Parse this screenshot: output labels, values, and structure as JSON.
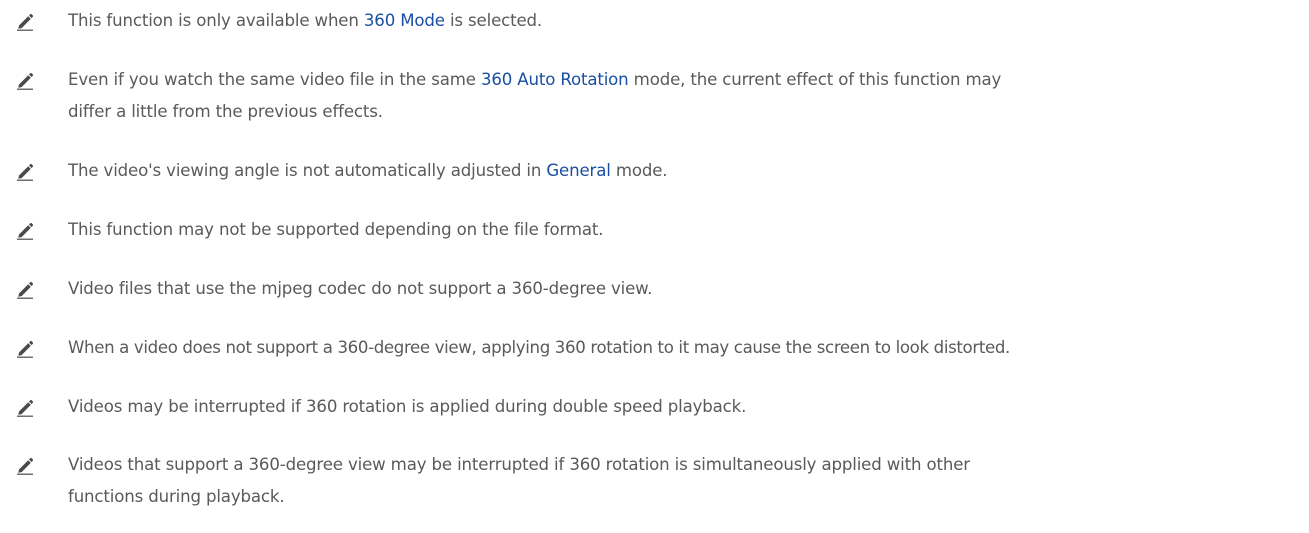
{
  "notes": [
    {
      "icon": "pencil-icon",
      "before": "This function is only available when ",
      "highlight": "360 Mode",
      "after": " is selected."
    },
    {
      "icon": "pencil-icon",
      "before": "Even if you watch the same video file in the same ",
      "highlight": "360 Auto Rotation",
      "after": " mode, the current effect of this function may",
      "line2": "differ a little from the previous effects."
    },
    {
      "icon": "pencil-icon",
      "before": "The video's viewing angle is not automatically adjusted in ",
      "highlight": "General",
      "after": " mode."
    },
    {
      "icon": "pencil-icon",
      "text": "This function may not be supported depending on the file format."
    },
    {
      "icon": "pencil-icon",
      "text": "Video files that use the mjpeg codec do not support a 360-degree view."
    },
    {
      "icon": "pencil-icon",
      "text": "When a video does not support a 360-degree view, applying 360 rotation to it may cause the screen to look distorted."
    },
    {
      "icon": "pencil-icon",
      "text": "Videos may be interrupted if 360 rotation is applied during double speed playback."
    },
    {
      "icon": "pencil-icon",
      "text": "Videos that support a 360-degree view may be interrupted if 360 rotation is simultaneously applied with other",
      "line2": "functions during playback."
    }
  ],
  "colors": {
    "text": "#5a5a5a",
    "highlight": "#1a4fa3",
    "icon": "#4a4a4a"
  }
}
